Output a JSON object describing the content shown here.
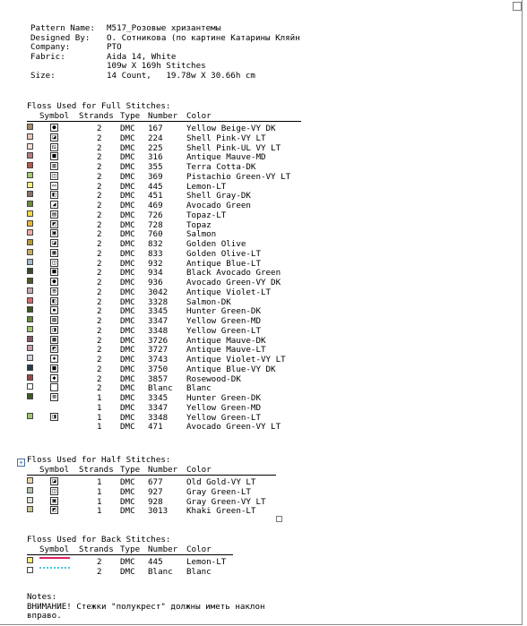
{
  "info": {
    "pattern_name_label": "Pattern Name:",
    "pattern_name": "M517_Розовые хризантемы",
    "designed_by_label": "Designed By:",
    "designed_by": "О. Сотникова (по картине Катарины Кляйн",
    "company_label": "Company:",
    "company": "PTO",
    "fabric_label": "Fabric:",
    "fabric": "Aida 14, White",
    "stitches": "109w X 169h Stitches",
    "size_label": "Size:",
    "size": "14 Count,   19.78w X 30.66h cm"
  },
  "headers": {
    "symbol": "Symbol",
    "strands": "Strands",
    "type": "Type",
    "number": "Number",
    "color": "Color"
  },
  "full": {
    "title": "Floss Used for Full Stitches:",
    "rows": [
      {
        "c": "#a58a68",
        "s": "●",
        "st": "2",
        "t": "DMC",
        "n": "167",
        "name": "Yellow Beige-VY DK"
      },
      {
        "c": "#e8c6b8",
        "s": "◪",
        "st": "2",
        "t": "DMC",
        "n": "224",
        "name": "Shell Pink-VY LT"
      },
      {
        "c": "#f2dcd6",
        "s": "⧅",
        "st": "2",
        "t": "DMC",
        "n": "225",
        "name": "Shell Pink-UL VY LT"
      },
      {
        "c": "#b77b7e",
        "s": "■",
        "st": "2",
        "t": "DMC",
        "n": "316",
        "name": "Antique Mauve-MD"
      },
      {
        "c": "#b05a4c",
        "s": "▥",
        "st": "2",
        "t": "DMC",
        "n": "355",
        "name": "Terra Cotta-DK"
      },
      {
        "c": "#a8c870",
        "s": "◫",
        "st": "2",
        "t": "DMC",
        "n": "369",
        "name": "Pistachio Green-VY LT"
      },
      {
        "c": "#f4ef7a",
        "s": "▭",
        "st": "2",
        "t": "DMC",
        "n": "445",
        "name": "Lemon-LT"
      },
      {
        "c": "#8a6f6a",
        "s": "◧",
        "st": "2",
        "t": "DMC",
        "n": "451",
        "name": "Shell Gray-DK"
      },
      {
        "c": "#6e8a3a",
        "s": "◢",
        "st": "2",
        "t": "DMC",
        "n": "469",
        "name": "Avocado Green"
      },
      {
        "c": "#f4d84a",
        "s": "▤",
        "st": "2",
        "t": "DMC",
        "n": "726",
        "name": "Topaz-LT"
      },
      {
        "c": "#e6b43a",
        "s": "◩",
        "st": "2",
        "t": "DMC",
        "n": "728",
        "name": "Topaz"
      },
      {
        "c": "#f0a8a8",
        "s": "▣",
        "st": "2",
        "t": "DMC",
        "n": "760",
        "name": "Salmon"
      },
      {
        "c": "#b89a3c",
        "s": "◪",
        "st": "2",
        "t": "DMC",
        "n": "832",
        "name": "Golden Olive"
      },
      {
        "c": "#c8b060",
        "s": "▦",
        "st": "2",
        "t": "DMC",
        "n": "833",
        "name": "Golden Olive-LT"
      },
      {
        "c": "#a4b8c8",
        "s": "◫",
        "st": "2",
        "t": "DMC",
        "n": "932",
        "name": "Antique Blue-LT"
      },
      {
        "c": "#3a4a2a",
        "s": "■",
        "st": "2",
        "t": "DMC",
        "n": "934",
        "name": "Black Avocado Green"
      },
      {
        "c": "#4a5c24",
        "s": "●",
        "st": "2",
        "t": "DMC",
        "n": "936",
        "name": "Avocado Green-VY DK"
      },
      {
        "c": "#c6aab8",
        "s": "⊞",
        "st": "2",
        "t": "DMC",
        "n": "3042",
        "name": "Antique Violet-LT"
      },
      {
        "c": "#d86a6a",
        "s": "◧",
        "st": "2",
        "t": "DMC",
        "n": "3328",
        "name": "Salmon-DK"
      },
      {
        "c": "#3e5a24",
        "s": "▪",
        "st": "2",
        "t": "DMC",
        "n": "3345",
        "name": "Hunter Green-DK"
      },
      {
        "c": "#6a8a3a",
        "s": "▧",
        "st": "2",
        "t": "DMC",
        "n": "3347",
        "name": "Yellow Green-MD"
      },
      {
        "c": "#a4c470",
        "s": "◨",
        "st": "2",
        "t": "DMC",
        "n": "3348",
        "name": "Yellow Green-LT"
      },
      {
        "c": "#8a5a64",
        "s": "▩",
        "st": "2",
        "t": "DMC",
        "n": "3726",
        "name": "Antique Mauve-DK"
      },
      {
        "c": "#c8a0a8",
        "s": "◩",
        "st": "2",
        "t": "DMC",
        "n": "3727",
        "name": "Antique Mauve-LT"
      },
      {
        "c": "#d8d0dc",
        "s": "◈",
        "st": "2",
        "t": "DMC",
        "n": "3743",
        "name": "Antique Violet-VY LT"
      },
      {
        "c": "#2a3a4c",
        "s": "■",
        "st": "2",
        "t": "DMC",
        "n": "3750",
        "name": "Antique Blue-VY DK"
      },
      {
        "c": "#9a4a4a",
        "s": "◆",
        "st": "2",
        "t": "DMC",
        "n": "3857",
        "name": "Rosewood-DK"
      },
      {
        "c": "#ffffff",
        "s": "",
        "st": "2",
        "t": "DMC",
        "n": "Blanc",
        "name": "Blanc"
      },
      {
        "c": "#3e5a24",
        "s": "⊠",
        "st": "1",
        "t": "DMC",
        "n": "3345",
        "name": "Hunter Green-DK",
        "pair": true
      },
      {
        "c": "#6a8a3a",
        "s": "",
        "st": "1",
        "t": "DMC",
        "n": "3347",
        "name": "Yellow Green-MD",
        "pairEnd": true
      },
      {
        "c": "#a4c470",
        "s": "◨",
        "st": "1",
        "t": "DMC",
        "n": "3348",
        "name": "Yellow Green-LT",
        "pair": true
      },
      {
        "c": "#6e8a3a",
        "s": "",
        "st": "1",
        "t": "DMC",
        "n": "471",
        "name": "Avocado Green-VY LT",
        "pairEnd": true
      }
    ]
  },
  "half": {
    "title": "Floss Used for Half Stitches:",
    "rows": [
      {
        "c": "#e8d9a8",
        "s": "◪",
        "st": "1",
        "t": "DMC",
        "n": "677",
        "name": "Old Gold-VY LT"
      },
      {
        "c": "#b8c4b0",
        "s": "◫",
        "st": "1",
        "t": "DMC",
        "n": "927",
        "name": "Gray Green-LT"
      },
      {
        "c": "#dce4d8",
        "s": "▣",
        "st": "1",
        "t": "DMC",
        "n": "928",
        "name": "Gray Green-VY LT"
      },
      {
        "c": "#c8c890",
        "s": "◩",
        "st": "1",
        "t": "DMC",
        "n": "3013",
        "name": "Khaki Green-LT"
      }
    ]
  },
  "back": {
    "title": "Floss Used for Back Stitches:",
    "rows": [
      {
        "c": "#f4ef7a",
        "line": "#e02060",
        "dash": false,
        "st": "2",
        "t": "DMC",
        "n": "445",
        "name": "Lemon-LT"
      },
      {
        "c": "#ffffff",
        "line": "#40c8d8",
        "dash": true,
        "st": "2",
        "t": "DMC",
        "n": "Blanc",
        "name": "Blanc"
      }
    ]
  },
  "notes": {
    "title": "Notes:",
    "line1": "ВНИМАНИЕ! Стежки \"полукрест\" должны иметь наклон",
    "line2": "вправо."
  }
}
